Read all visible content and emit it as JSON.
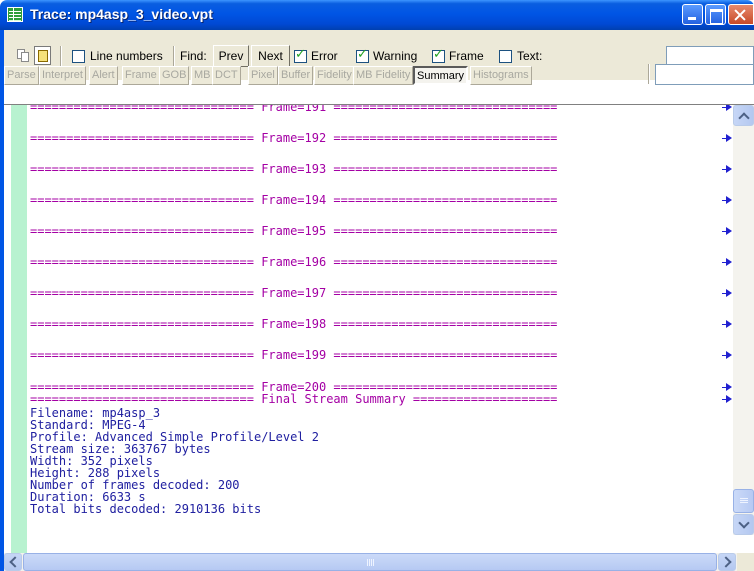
{
  "window": {
    "title": "Trace: mp4asp_3_video.vpt"
  },
  "toolbar": {
    "line_numbers_label": "Line numbers",
    "line_numbers_checked": false,
    "find_label": "Find:",
    "prev_label": "Prev",
    "next_label": "Next",
    "error_label": "Error",
    "error_checked": true,
    "warning_label": "Warning",
    "warning_checked": true,
    "frame_label": "Frame",
    "frame_checked": true,
    "text_label": "Text:",
    "text_checked": false,
    "find_value": ""
  },
  "tabs": [
    {
      "label": "Parse",
      "active": false
    },
    {
      "label": "Interpret",
      "active": false
    },
    {
      "label": "Alert",
      "active": false
    },
    {
      "label": "Frame",
      "active": false
    },
    {
      "label": "GOB",
      "active": false
    },
    {
      "label": "MB",
      "active": false
    },
    {
      "label": "DCT",
      "active": false
    },
    {
      "label": "Pixel",
      "active": false
    },
    {
      "label": "Buffer",
      "active": false
    },
    {
      "label": "Fidelity",
      "active": false
    },
    {
      "label": "MB Fidelity",
      "active": false
    },
    {
      "label": "Summary",
      "active": true
    },
    {
      "label": "Histograms",
      "active": false
    }
  ],
  "tab_input_value": "",
  "trace": {
    "frame_lines": [
      "=============================== Frame=191 ===============================",
      "=============================== Frame=192 ===============================",
      "=============================== Frame=193 ===============================",
      "=============================== Frame=194 ===============================",
      "=============================== Frame=195 ===============================",
      "=============================== Frame=196 ===============================",
      "=============================== Frame=197 ===============================",
      "=============================== Frame=198 ===============================",
      "=============================== Frame=199 ===============================",
      "=============================== Frame=200 ==============================="
    ],
    "summary_header": "=============================== Final Stream Summary ====================",
    "summary_lines": [
      "Filename: mp4asp_3",
      "Standard: MPEG-4",
      "Profile: Advanced Simple Profile/Level 2",
      "Stream size: 363767 bytes",
      "Width: 352 pixels",
      "Height: 288 pixels",
      "Number of frames decoded: 200",
      "Duration: 6633 s",
      "Total bits decoded: 2910136 bits"
    ]
  },
  "colors": {
    "frame_text": "#a400a4",
    "info_text": "#2020a0",
    "gutter": "#b8f2d0",
    "titlebar": "#0055e5"
  }
}
